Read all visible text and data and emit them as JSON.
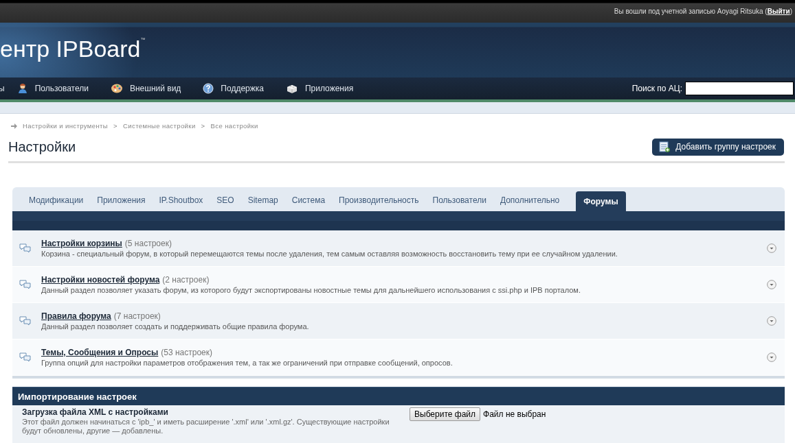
{
  "top_bar": {
    "logged_in_text": "Вы вошли под учетной записью Aoyagi Ritsuka (",
    "logout_link": "Выйти",
    "closing": ")"
  },
  "header": {
    "logo": "ентр IPBoard",
    "trademark": "™"
  },
  "nav": {
    "items": [
      {
        "label": "ы"
      },
      {
        "label": "Пользователи"
      },
      {
        "label": "Внешний вид"
      },
      {
        "label": "Поддержка"
      },
      {
        "label": "Приложения"
      }
    ],
    "search_label": "Поиск по АЦ:"
  },
  "breadcrumb": [
    "Настройки и инструменты",
    "Системные настройки",
    "Все настройки"
  ],
  "breadcrumb_separator": ">",
  "page_title": "Настройки",
  "add_button": "Добавить группу настроек",
  "tabs": [
    {
      "label": "Модификации",
      "selected": false
    },
    {
      "label": "Приложения",
      "selected": false
    },
    {
      "label": "IP.Shoutbox",
      "selected": false
    },
    {
      "label": "SEO",
      "selected": false
    },
    {
      "label": "Sitemap",
      "selected": false
    },
    {
      "label": "Система",
      "selected": false
    },
    {
      "label": "Производительность",
      "selected": false
    },
    {
      "label": "Пользователи",
      "selected": false
    },
    {
      "label": "Дополнительно",
      "selected": false
    },
    {
      "label": "Форумы",
      "selected": true
    }
  ],
  "groups": [
    {
      "title": "Настройки корзины",
      "count": "(5 настроек)",
      "description": "Корзина - специальный форум, в который перемещаются темы после удаления, тем самым оставляя возможность восстановить тему при ее случайном удалении."
    },
    {
      "title": "Настройки новостей форума",
      "count": "(2 настроек)",
      "description": "Данный раздел позволяет указать форум, из которого будут экспортированы новостные темы для дальнейшего использования с ssi.php и IPB порталом."
    },
    {
      "title": "Правила форума",
      "count": "(7 настроек)",
      "description": "Данный раздел позволяет создать и поддерживать общие правила форума."
    },
    {
      "title": "Темы, Сообщения и Опросы",
      "count": "(53 настроек)",
      "description": "Группа опций для настройки параметров отображения тем, а так же ограничений при отправке сообщений, опросов."
    }
  ],
  "import": {
    "header": "Импортирование настроек",
    "label": "Загрузка файла XML с настройками",
    "hint": "Этот файл должен начинаться с 'ipb_' и иметь расширение '.xml' или '.xml.gz'. Существующие настройки будут обновлены, другие — добавлены.",
    "file_button": "Выберите файл",
    "file_status": "Файл не выбран"
  }
}
